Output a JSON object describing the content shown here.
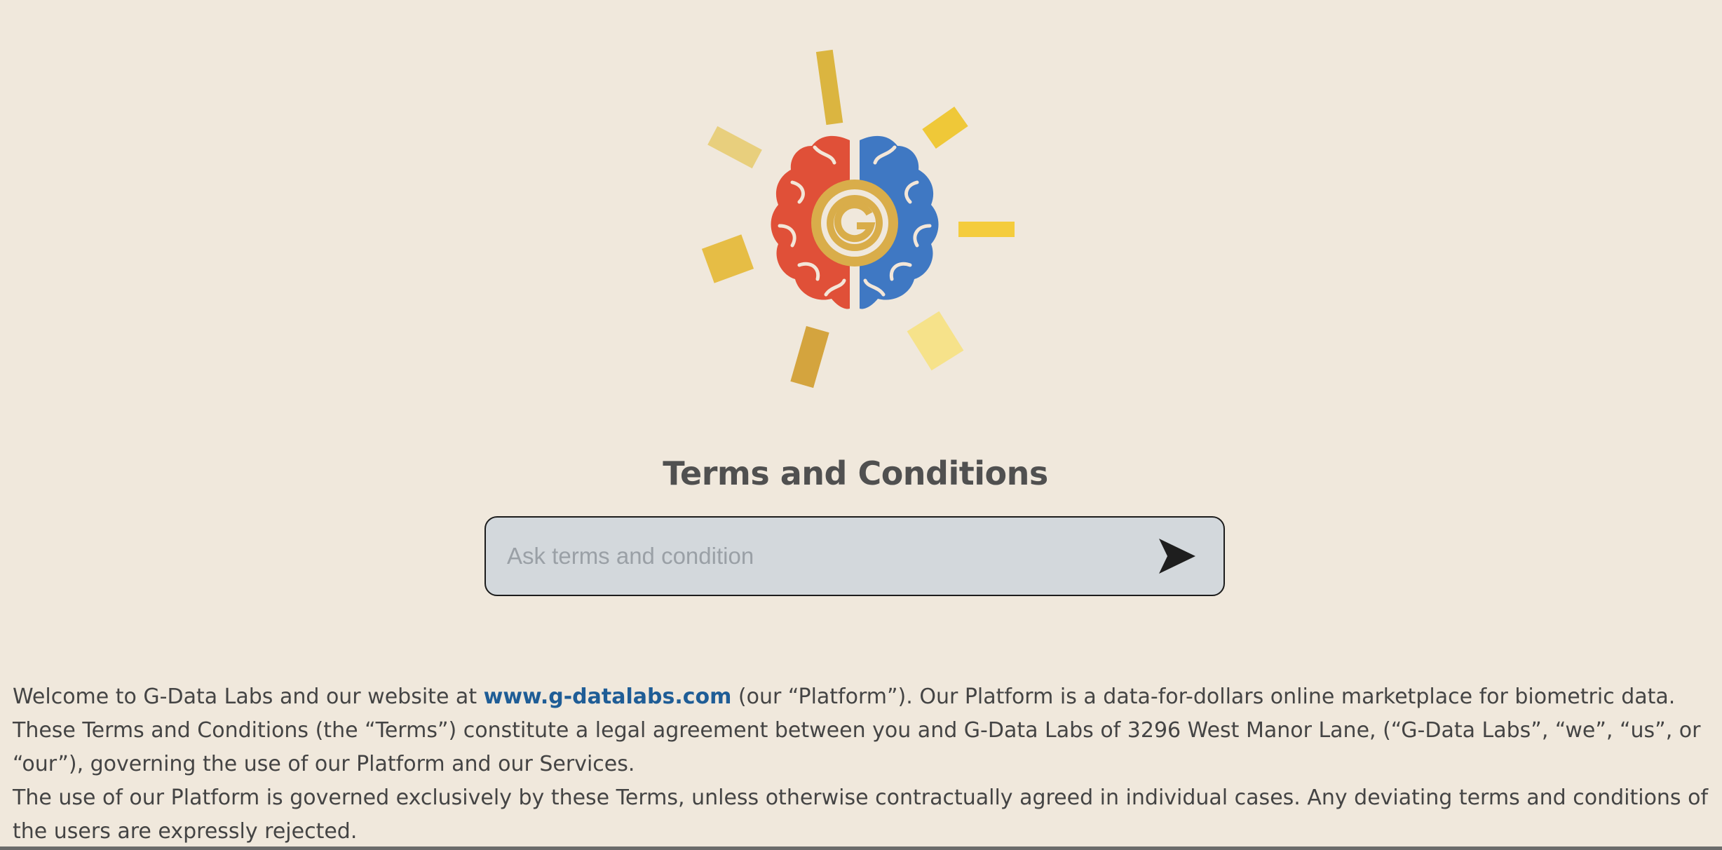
{
  "page": {
    "title": "Terms and Conditions"
  },
  "logo": {
    "icon": "brain-gear-logo",
    "letter": "G",
    "colors": {
      "left_hemisphere": "#e05038",
      "right_hemisphere": "#3f78c3",
      "gear": "#d9ad4a",
      "rays": [
        "#dbb540",
        "#e8cf7d",
        "#efc838",
        "#e6bd45",
        "#f4cc3d",
        "#d4a43e",
        "#f6e28a"
      ]
    }
  },
  "search": {
    "placeholder": "Ask terms and condition",
    "value": "",
    "send_icon": "send-arrow-icon"
  },
  "terms": {
    "p1_before_link": "Welcome to G-Data Labs and our website at ",
    "link_text": "www.g-datalabs.com",
    "p1_after_link": " (our “Platform”). Our Platform is a data-for-dollars online marketplace for biometric data. These Terms and Conditions (the “Terms”) constitute a legal agreement between you and G-Data Labs of 3296 West Manor Lane, (“G-Data Labs”, “we”, “us”, or “our”), governing the use of our Platform and our Services.",
    "p2": "The use of our Platform is governed exclusively by these Terms, unless otherwise contractually agreed in individual cases. Any deviating terms and conditions of the users are expressly rejected."
  },
  "colors": {
    "background": "#f0e8dc",
    "input_background": "#d3d8dc",
    "link": "#1f5d96",
    "text": "#444444"
  }
}
